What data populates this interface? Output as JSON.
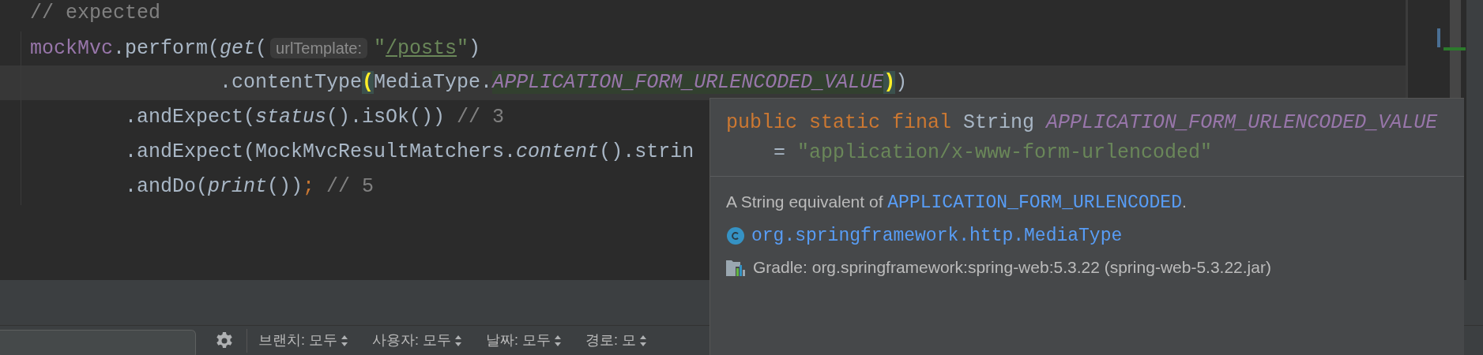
{
  "editor": {
    "lines": [
      {
        "current": false,
        "tokens": [
          {
            "kind": "comment",
            "text": "// expected"
          }
        ]
      },
      {
        "current": false,
        "tokens": [
          {
            "kind": "field",
            "text": "mockMvc"
          },
          {
            "kind": "plain",
            "text": ".perform("
          },
          {
            "kind": "call",
            "text": "get"
          },
          {
            "kind": "plain",
            "text": "("
          },
          {
            "kind": "hint",
            "text": "urlTemplate:"
          },
          {
            "kind": "string",
            "text": "\""
          },
          {
            "kind": "url",
            "text": "/posts"
          },
          {
            "kind": "string",
            "text": "\""
          },
          {
            "kind": "plain",
            "text": ")"
          }
        ]
      },
      {
        "current": true,
        "tokens": [
          {
            "kind": "plain",
            "text": "                .contentType"
          },
          {
            "kind": "brace",
            "text": "("
          },
          {
            "kind": "plain",
            "text": "MediaType."
          },
          {
            "kind": "constant",
            "text": "APPLICATION_FORM_URLENCODED_VALUE"
          },
          {
            "kind": "brace",
            "text": ")"
          },
          {
            "kind": "plain",
            "text": ")"
          }
        ]
      },
      {
        "current": false,
        "tokens": [
          {
            "kind": "plain",
            "text": "        .andExpect("
          },
          {
            "kind": "call",
            "text": "status"
          },
          {
            "kind": "plain",
            "text": "().isOk()) "
          },
          {
            "kind": "comment",
            "text": "// 3"
          }
        ]
      },
      {
        "current": false,
        "tokens": [
          {
            "kind": "plain",
            "text": "        .andExpect(MockMvcResultMatchers."
          },
          {
            "kind": "call",
            "text": "content"
          },
          {
            "kind": "plain",
            "text": "().strin"
          }
        ]
      },
      {
        "current": false,
        "tokens": [
          {
            "kind": "plain",
            "text": "        .andDo("
          },
          {
            "kind": "call",
            "text": "print"
          },
          {
            "kind": "plain",
            "text": "())"
          },
          {
            "kind": "keyword",
            "text": ";"
          },
          {
            "kind": "comment",
            "text": " // 5"
          }
        ]
      }
    ]
  },
  "toolbar": {
    "filters": [
      {
        "label": "브랜치: 모두"
      },
      {
        "label": "사용자: 모두"
      },
      {
        "label": "날짜: 모두"
      },
      {
        "label": "경로: 모"
      }
    ]
  },
  "tooltip": {
    "signature": [
      [
        {
          "kind": "keyword",
          "text": "public static final "
        },
        {
          "kind": "plain",
          "text": "String "
        },
        {
          "kind": "field",
          "text": "APPLICATION_FORM_URLENCODED_VALUE"
        }
      ],
      [
        {
          "kind": "plain",
          "text": "    = "
        },
        {
          "kind": "string",
          "text": "\"application/x-www-form-urlencoded\""
        }
      ]
    ],
    "description": {
      "text": "A String equivalent of ",
      "link": "APPLICATION_FORM_URLENCODED",
      "suffix": "."
    },
    "class_link": "org.springframework.http.MediaType",
    "library": "Gradle: org.springframework:spring-web:5.3.22 (spring-web-5.3.22.jar)"
  }
}
